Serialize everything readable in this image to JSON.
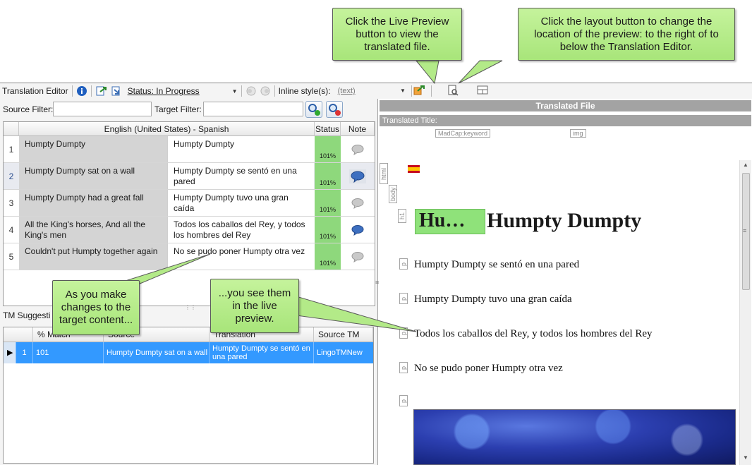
{
  "toolbar": {
    "title": "Translation Editor",
    "status_label": "Status: In Progress",
    "inline_styles_label": "Inline style(s):",
    "inline_styles_value": "(text)"
  },
  "filters": {
    "source_label": "Source Filter:",
    "target_label": "Target Filter:",
    "source_value": "",
    "target_value": ""
  },
  "grid": {
    "header_language": "English (United States) - Spanish",
    "header_status": "Status",
    "header_note": "Note",
    "rows": [
      {
        "num": "1",
        "source": "Humpty Dumpty",
        "target": "Humpty Dumpty",
        "match": "101%"
      },
      {
        "num": "2",
        "source": "Humpty Dumpty sat on a wall",
        "target": "Humpty Dumpty se sentó en una pared",
        "match": "101%"
      },
      {
        "num": "3",
        "source": "Humpty Dumpty had a great fall",
        "target": "Humpty Dumpty tuvo una gran caída",
        "match": "101%"
      },
      {
        "num": "4",
        "source": "All the King's horses, And all the King's men",
        "target": "Todos los caballos del Rey, y todos los hombres del Rey",
        "match": "101%"
      },
      {
        "num": "5",
        "source": "Couldn't put Humpty together again",
        "target": "No se pudo poner Humpty otra vez",
        "match": "101%"
      }
    ]
  },
  "tm": {
    "title": "TM Suggesti",
    "headers": {
      "match": "% Match",
      "source": "Source",
      "translation": "Translation",
      "source_tm": "Source TM"
    },
    "row": {
      "num": "1",
      "match": "101",
      "source": "Humpty Dumpty sat on a wall",
      "translation": "Humpty Dumpty se sentó en una pared",
      "source_tm": "LingoTMNew"
    }
  },
  "preview": {
    "header": "Translated File",
    "title_label": "Translated Title:",
    "tag_keyword": "MadCap:keyword",
    "tag_img": "img",
    "tag_html": "html",
    "tag_body": "body",
    "tag_h1": "h1",
    "tag_p": "p",
    "heading_highlight": "Hu…",
    "heading": "Humpty Dumpty",
    "paragraphs": [
      "Humpty Dumpty se sentó en una pared",
      "Humpty Dumpty tuvo una gran caída",
      "Todos los caballos del Rey, y todos los hombres del Rey",
      "No se pudo poner Humpty otra vez"
    ]
  },
  "callouts": {
    "live_preview": "Click the Live Preview button to view the translated file.",
    "layout": "Click the layout button to change the location of the preview: to the right of to below the Translation Editor.",
    "changes": "As you make changes to the target content...",
    "see_them": "...you see them in the live preview."
  },
  "colors": {
    "callout_fill": "#b3ea88",
    "match_green": "#8ed87c",
    "selection_blue": "#3399ff",
    "preview_header": "#a3a3a3"
  }
}
